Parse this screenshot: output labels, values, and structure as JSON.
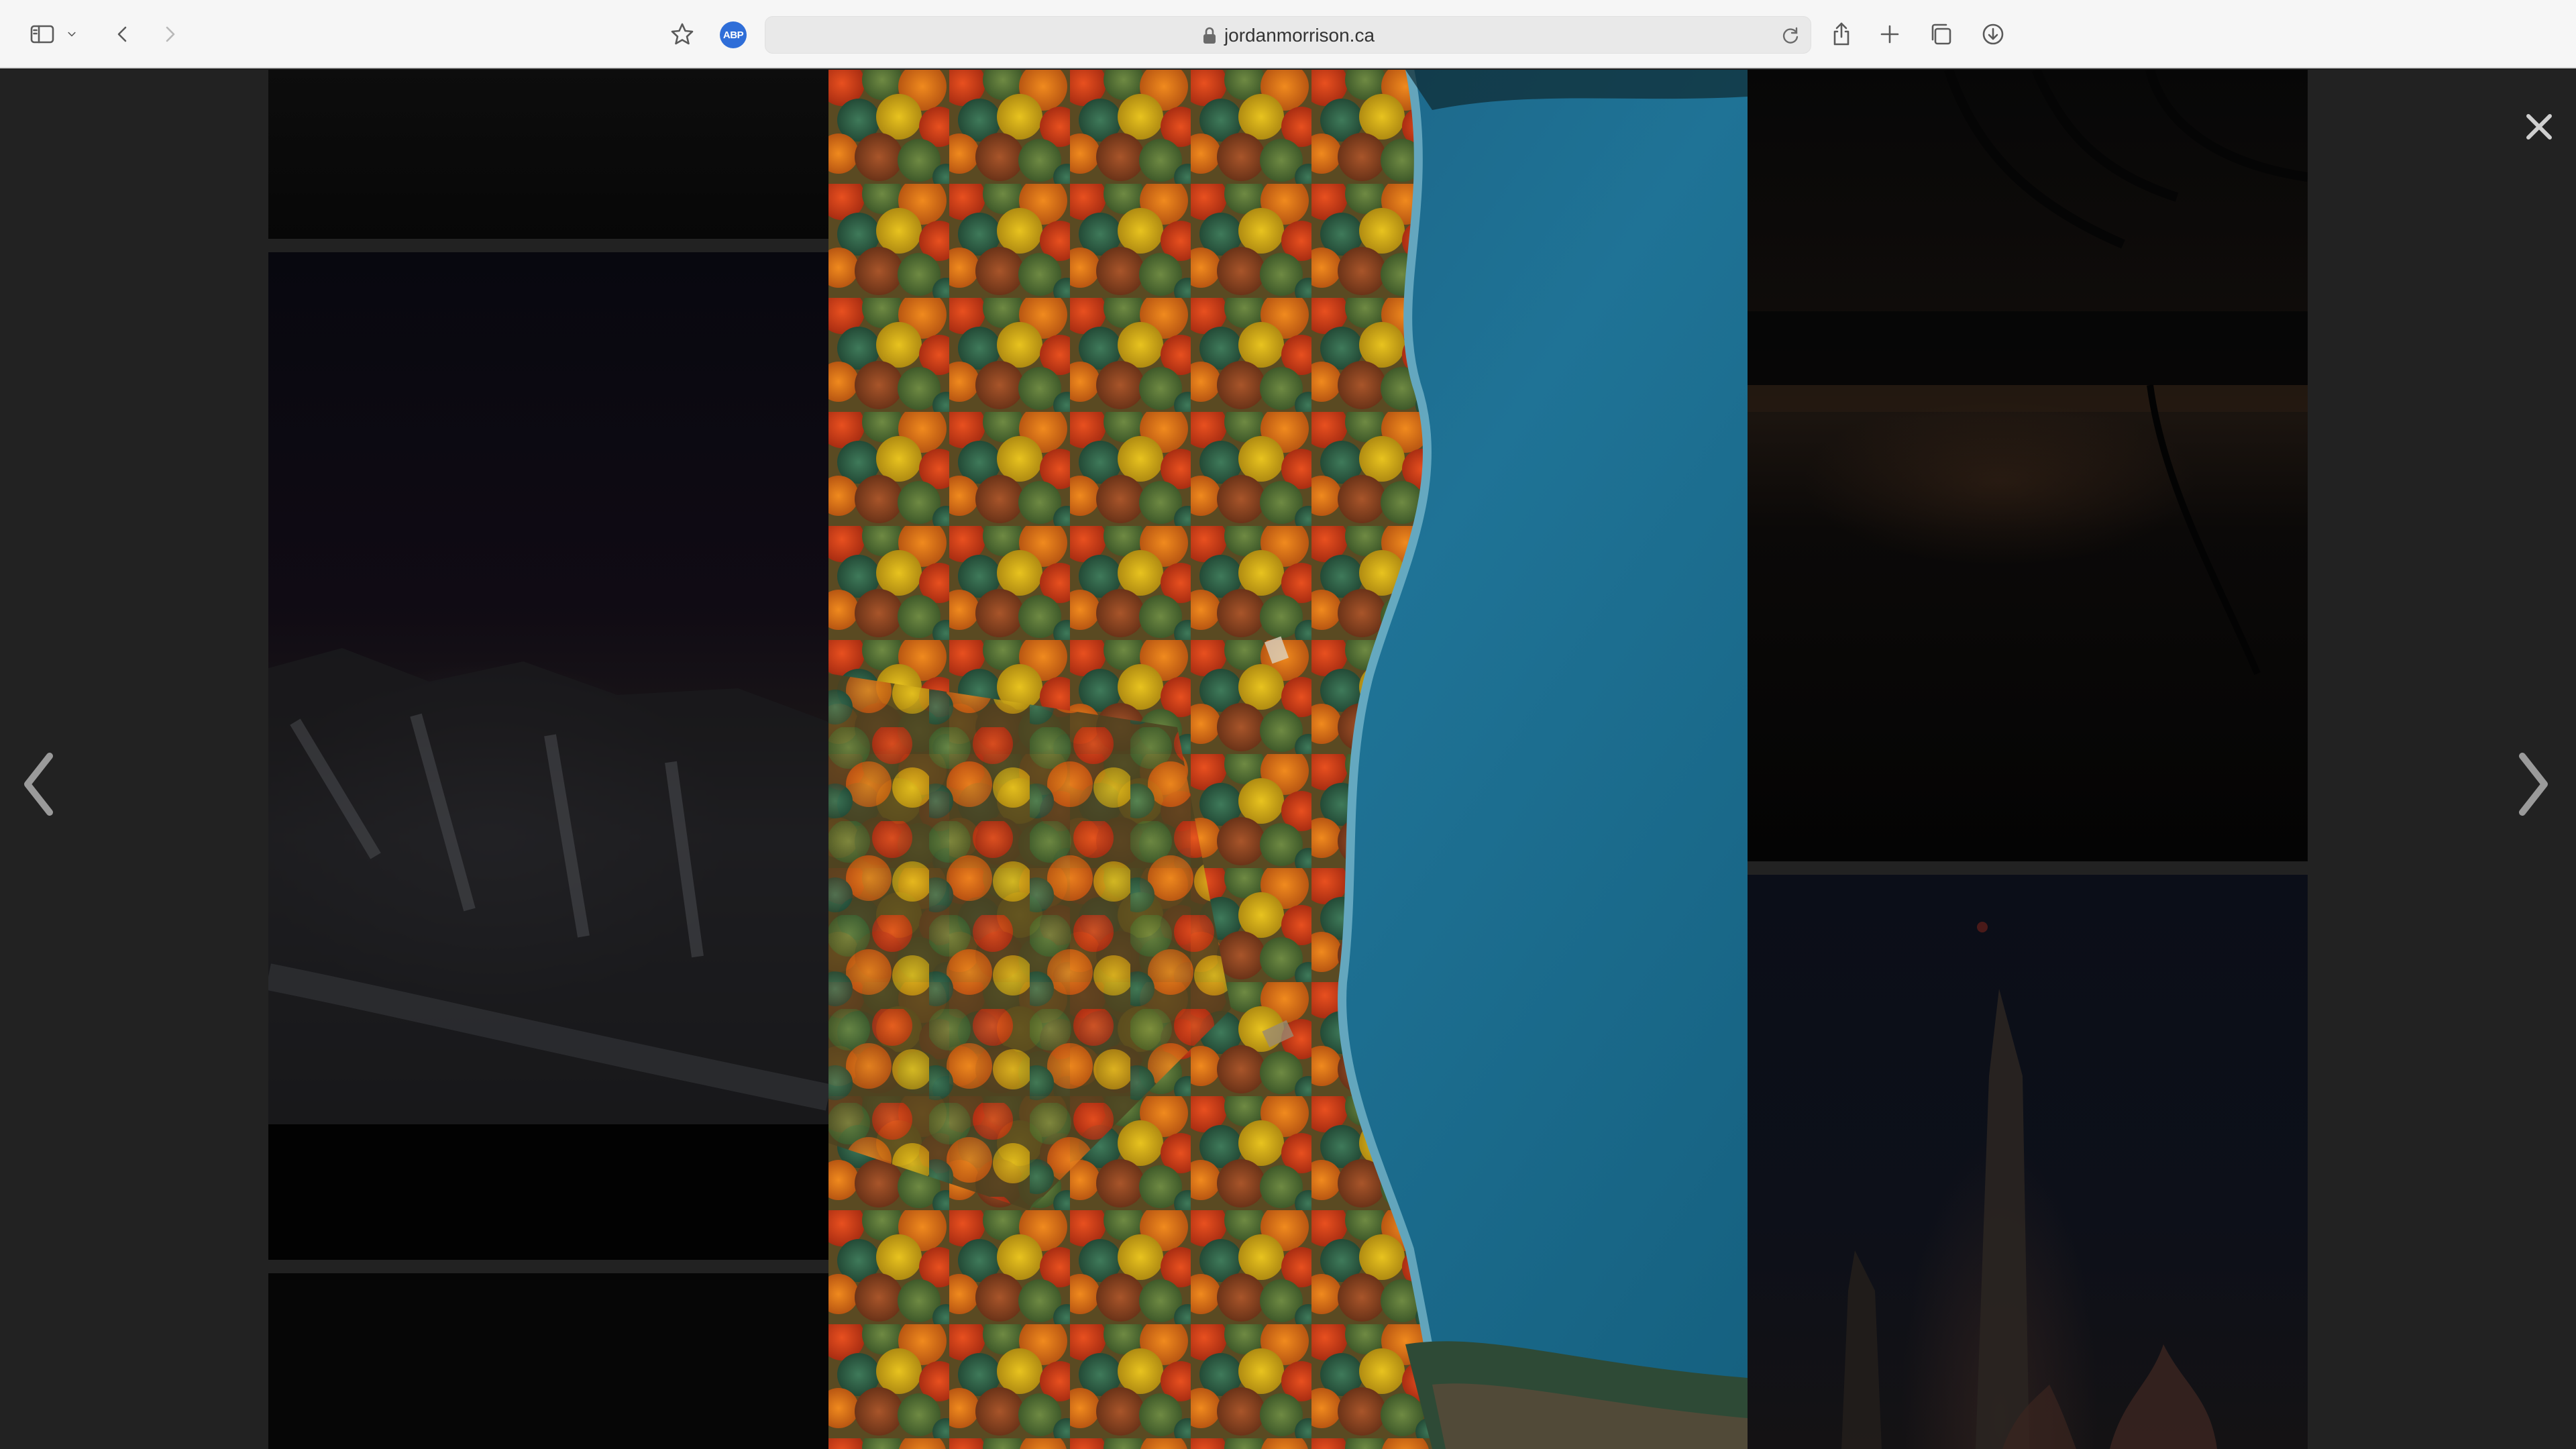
{
  "browser": {
    "url": "jordanmorrison.ca",
    "extension_label": "ABP",
    "icons": {
      "sidebar": "sidebar-icon",
      "sidebar_menu": "chevron-down-icon",
      "back": "back-arrow-icon",
      "forward": "forward-arrow-icon",
      "bookmark": "star-icon",
      "secure": "lock-icon",
      "reload": "reload-icon",
      "share": "share-icon",
      "new_tab": "plus-icon",
      "tabs": "tab-overview-icon",
      "downloads": "download-icon"
    },
    "extension_color": "#2f6ed8"
  },
  "lightbox": {
    "icons": {
      "close": "close-icon",
      "previous": "chevron-left-icon",
      "next": "chevron-right-icon"
    },
    "main_image": "aerial view of autumn forest along a blue lake shoreline",
    "colors": {
      "background": "#222222",
      "water": "#1d6b8e"
    }
  }
}
